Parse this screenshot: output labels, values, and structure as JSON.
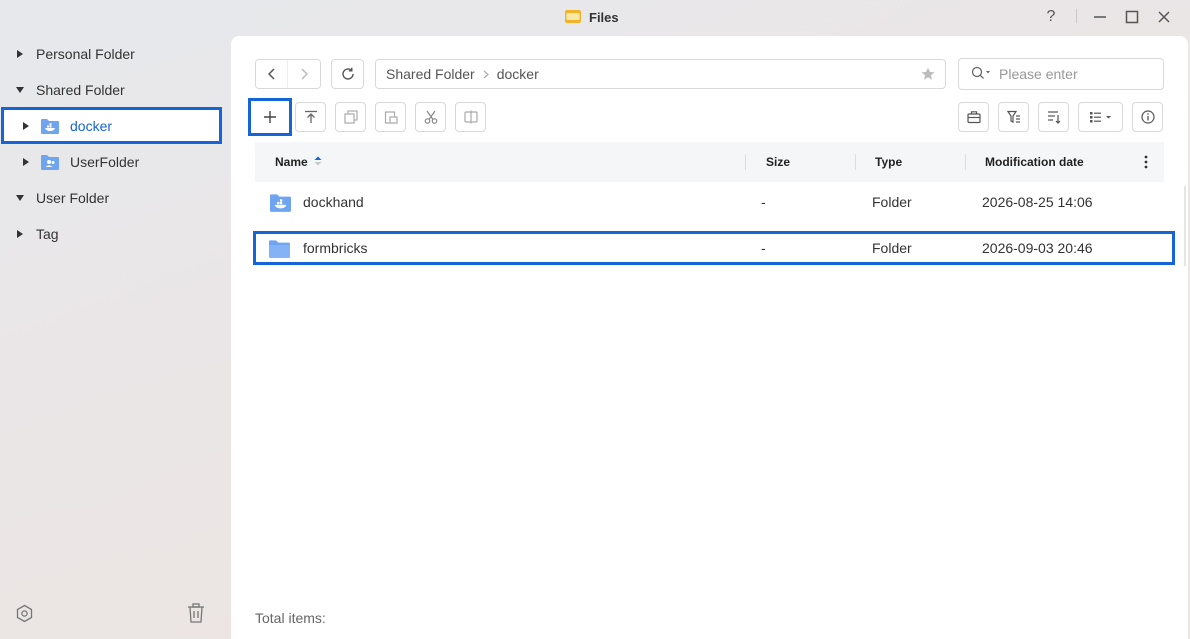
{
  "window": {
    "title": "Files",
    "help": "?"
  },
  "sidebar": {
    "items": [
      {
        "label": "Personal Folder",
        "expanded": false
      },
      {
        "label": "Shared Folder",
        "expanded": true
      },
      {
        "label": "docker",
        "expanded": false,
        "selected": true,
        "icon": "docker-folder-icon"
      },
      {
        "label": "UserFolder",
        "expanded": false,
        "icon": "user-folder-icon"
      },
      {
        "label": "User Folder",
        "expanded": true
      },
      {
        "label": "Tag",
        "expanded": false
      }
    ]
  },
  "breadcrumb": {
    "root": "Shared Folder",
    "current": "docker"
  },
  "search": {
    "placeholder": "Please enter",
    "value": ""
  },
  "table": {
    "columns": {
      "name": "Name",
      "size": "Size",
      "type": "Type",
      "modified": "Modification date"
    },
    "rows": [
      {
        "name": "dockhand",
        "size": "-",
        "type": "Folder",
        "modified": "2026-08-25 14:06",
        "icon": "docker-folder-icon"
      },
      {
        "name": "formbricks",
        "size": "-",
        "type": "Folder",
        "modified": "2026-09-03 20:46",
        "icon": "folder-icon"
      }
    ]
  },
  "footer": {
    "total_label": "Total items:"
  },
  "colors": {
    "accent": "#1565d8",
    "folder": "#6fa4f0"
  }
}
